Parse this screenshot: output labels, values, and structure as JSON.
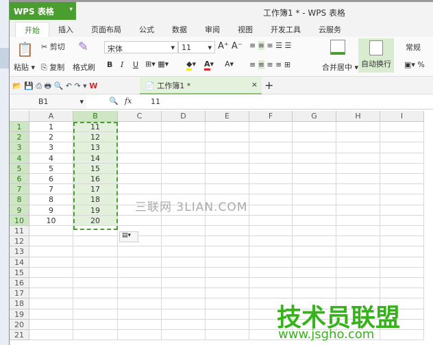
{
  "app": {
    "button": "WPS 表格",
    "title": "工作簿1 * - WPS 表格"
  },
  "tabs": [
    "开始",
    "插入",
    "页面布局",
    "公式",
    "数据",
    "审阅",
    "视图",
    "开发工具",
    "云服务"
  ],
  "ribbon": {
    "paste": "粘贴",
    "cut": "剪切",
    "copy": "复制",
    "format_painter": "格式刷",
    "font": "宋体",
    "size": "11",
    "bold": "B",
    "italic": "I",
    "underline": "U",
    "merge": "合并居中",
    "wrap": "自动换行",
    "number_format": "常规",
    "percent": "%"
  },
  "doc_tab": {
    "label": "工作簿1 *",
    "close": "×",
    "add": "+"
  },
  "formula": {
    "name_box": "B1",
    "fx": "fx",
    "value": "11"
  },
  "columns": [
    "A",
    "B",
    "C",
    "D",
    "E",
    "F",
    "G",
    "H",
    "I"
  ],
  "rows": [
    "1",
    "2",
    "3",
    "4",
    "5",
    "6",
    "7",
    "8",
    "9",
    "10",
    "11",
    "12",
    "13",
    "14",
    "15",
    "16",
    "17",
    "18",
    "19",
    "20",
    "21"
  ],
  "colA": [
    "1",
    "2",
    "3",
    "4",
    "5",
    "6",
    "7",
    "8",
    "9",
    "10"
  ],
  "colB": [
    "11",
    "12",
    "13",
    "14",
    "15",
    "16",
    "17",
    "18",
    "19",
    "20"
  ],
  "watermarks": {
    "center": "三联网 3LIAN.COM",
    "brand": "技术员联盟",
    "url": "www.jsgho.com"
  }
}
